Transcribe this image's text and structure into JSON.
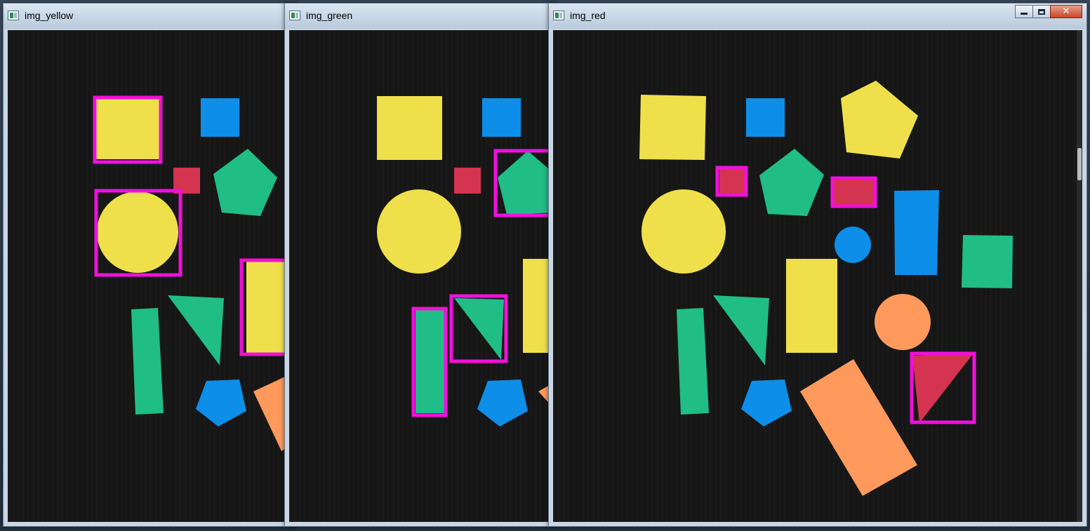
{
  "windows": [
    {
      "title": "img_yellow",
      "detected_color": "yellow",
      "detected_count": 3
    },
    {
      "title": "img_green",
      "detected_color": "green",
      "detected_count": 3
    },
    {
      "title": "img_red",
      "detected_color": "red",
      "detected_count": 3,
      "controls": [
        "minimize",
        "maximize",
        "close"
      ]
    }
  ],
  "colors": {
    "background": "#161616",
    "yellow": "#efe04b",
    "blue": "#0d8ee8",
    "green": "#20bd87",
    "red": "#d43450",
    "orange": "#ff9a5c",
    "box": "#f20fdc"
  },
  "icons": {
    "app_icon": "app-window-icon",
    "minimize": "minimize-icon",
    "maximize": "maximize-icon",
    "close": "close-icon"
  }
}
